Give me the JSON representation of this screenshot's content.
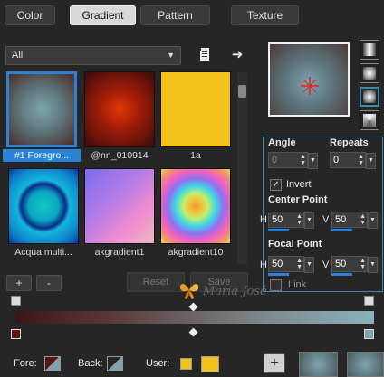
{
  "tabs": [
    {
      "label": "Color"
    },
    {
      "label": "Gradient"
    },
    {
      "label": "Pattern"
    },
    {
      "label": "Texture"
    }
  ],
  "filter": {
    "selected": "All"
  },
  "gradients": [
    {
      "label": "#1 Foregro..."
    },
    {
      "label": "@nn_010914"
    },
    {
      "label": "1a"
    },
    {
      "label": "Acqua multi..."
    },
    {
      "label": "akgradient1"
    },
    {
      "label": "akgradient10"
    }
  ],
  "buttons": {
    "add": "+",
    "remove": "-",
    "reset": "Reset",
    "save": "Save"
  },
  "properties": {
    "angle_label": "Angle",
    "angle_value": "0",
    "repeats_label": "Repeats",
    "repeats_value": "0",
    "invert_label": "Invert",
    "invert_checked": true,
    "center_point_label": "Center Point",
    "center_h_label": "H",
    "center_h_value": "50",
    "center_v_label": "V",
    "center_v_value": "50",
    "focal_point_label": "Focal Point",
    "focal_h_label": "H",
    "focal_h_value": "50",
    "focal_v_label": "V",
    "focal_v_value": "50",
    "link_label": "Link",
    "link_checked": false
  },
  "watermark": "Maria José",
  "bottom": {
    "fore_label": "Fore:",
    "back_label": "Back:",
    "user_label": "User:",
    "add_button": "+"
  },
  "colors": {
    "selection": "#2a83d6",
    "fore": "#5a1616",
    "back": "#7fa4b0",
    "user1": "#f2c21a",
    "user2": "#f2c21a"
  }
}
